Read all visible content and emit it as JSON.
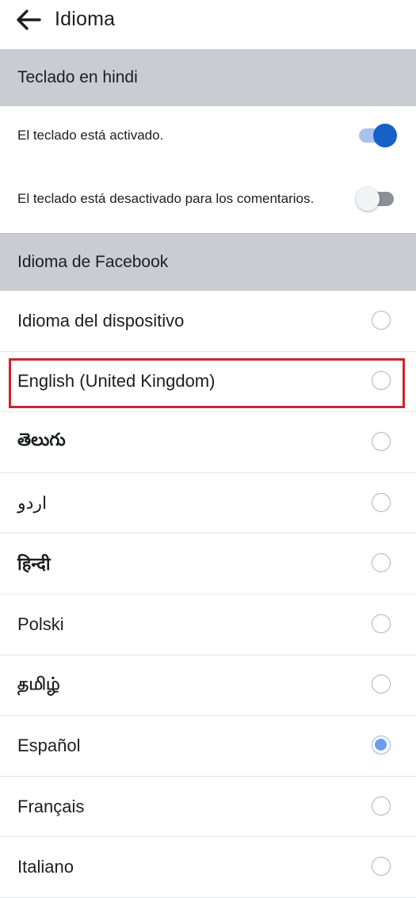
{
  "header": {
    "title": "Idioma",
    "back_icon": "arrow-left-icon"
  },
  "keyboard_section": {
    "title": "Teclado en hindi",
    "items": [
      {
        "label": "El teclado está activado.",
        "enabled": true
      },
      {
        "label": "El teclado está desactivado para los comentarios.",
        "enabled": false
      }
    ]
  },
  "language_section": {
    "title": "Idioma de Facebook",
    "items": [
      {
        "label": "Idioma del dispositivo",
        "selected": false
      },
      {
        "label": "English (United Kingdom)",
        "selected": false,
        "highlighted": true
      },
      {
        "label": "తెలుగు",
        "selected": false
      },
      {
        "label": "اردو",
        "selected": false
      },
      {
        "label": "हिन्दी",
        "selected": false
      },
      {
        "label": "Polski",
        "selected": false
      },
      {
        "label": "தமிழ்",
        "selected": false
      },
      {
        "label": "Español",
        "selected": true
      },
      {
        "label": "Français",
        "selected": false
      },
      {
        "label": "Italiano",
        "selected": false
      }
    ]
  },
  "colors": {
    "section_bg": "#c9ccd1",
    "toggle_on": "#1660c7",
    "radio_selected": "#6d9cf0",
    "highlight": "#d0232b"
  }
}
